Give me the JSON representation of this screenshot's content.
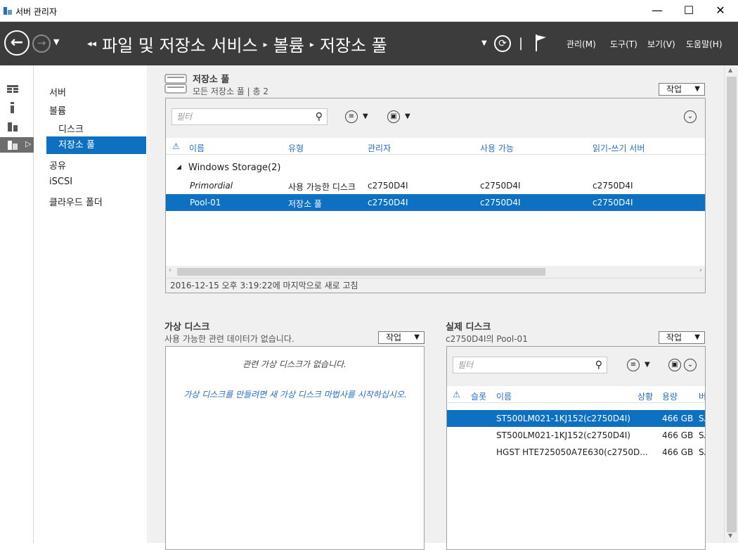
{
  "window": {
    "title": "서버 관리자",
    "minimize": "—",
    "maximize": "☐",
    "close": "✕"
  },
  "cmdbar": {
    "breadcrumb": [
      "파일 및 저장소 서비스",
      "볼륨",
      "저장소 풀"
    ],
    "menu": [
      "관리(M)",
      "도구(T)",
      "보기(V)",
      "도움말(H)"
    ]
  },
  "nav": {
    "items": [
      "서버",
      "볼륨",
      "디스크",
      "저장소 풀",
      "공유",
      "iSCSI",
      "클라우드 폴더"
    ]
  },
  "pools": {
    "title": "저장소 풀",
    "subtitle": "모든 저장소 풀 | 총 2",
    "task": "작업",
    "filter_placeholder": "필터",
    "columns": [
      "이름",
      "유형",
      "관리자",
      "사용 가능",
      "읽기-쓰기 서버"
    ],
    "group": "Windows Storage(2)",
    "rows": [
      {
        "name": "Primordial",
        "type": "사용 가능한 디스크",
        "manager": "c2750D4I",
        "available": "c2750D4I",
        "rw": "c2750D4I"
      },
      {
        "name": "Pool-01",
        "type": "저장소 풀",
        "manager": "c2750D4I",
        "available": "c2750D4I",
        "rw": "c2750D4I"
      }
    ],
    "status": "2016-12-15 오후 3:19:22에 마지막으로 새로 고침"
  },
  "vdisk": {
    "title": "가상 디스크",
    "subtitle": "사용 가능한 관련 데이터가 없습니다.",
    "task": "작업",
    "empty": "관련 가상 디스크가 없습니다.",
    "link": "가상 디스크를 만들려면 새 가상 디스크 마법사를 시작하십시오."
  },
  "pdisk": {
    "title": "실제 디스크",
    "subtitle": "c2750D4I의 Pool-01",
    "task": "작업",
    "filter_placeholder": "필터",
    "columns": [
      "슬롯",
      "이름",
      "상황",
      "용량",
      "버"
    ],
    "rows": [
      {
        "name": "ST500LM021-1KJ152(c2750D4I)",
        "capacity": "466 GB",
        "bus": "SA"
      },
      {
        "name": "ST500LM021-1KJ152(c2750D4I)",
        "capacity": "466 GB",
        "bus": "SA"
      },
      {
        "name": "HGST HTE725050A7E630(c2750D...",
        "capacity": "466 GB",
        "bus": "SA"
      }
    ]
  },
  "colors": {
    "accent": "#0e70c0",
    "cmdbar": "#3c3c3c",
    "link": "#2a6ebf"
  }
}
